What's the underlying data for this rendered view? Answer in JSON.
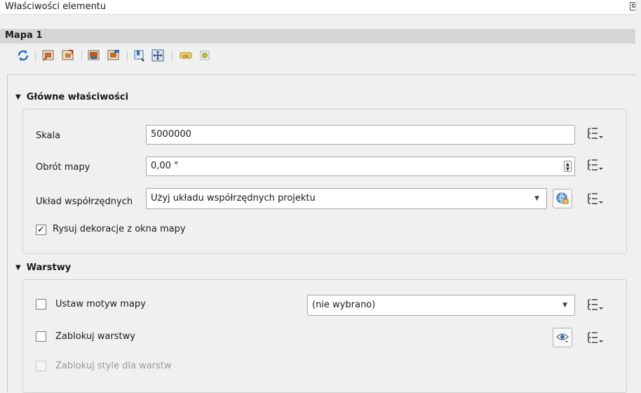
{
  "window": {
    "title": "Właściwości elementu"
  },
  "item": {
    "name": "Mapa 1"
  },
  "toolbar": {
    "icons": [
      "refresh-icon",
      "set-extent-from-canvas-icon",
      "view-extent-in-canvas-icon",
      "set-scale-from-canvas-icon",
      "set-canvas-scale-icon",
      "bookmarks-icon",
      "move-content-icon",
      "label-settings-icon",
      "clipping-settings-icon"
    ]
  },
  "main_properties": {
    "header": "Główne właściwości",
    "scale_label": "Skala",
    "scale_value": "5000000",
    "rotation_label": "Obrót mapy",
    "rotation_value": "0,00 °",
    "crs_label": "Układ współrzędnych",
    "crs_value": "Użyj układu współrzędnych projektu",
    "draw_decorations_label": "Rysuj dekoracje z okna mapy",
    "draw_decorations_checked": true
  },
  "layers": {
    "header": "Warstwy",
    "follow_theme_label": "Ustaw motyw mapy",
    "theme_value": "(nie wybrano)",
    "lock_layers_label": "Zablokuj warstwy",
    "lock_styles_label": "Zablokuj style dla warstw"
  },
  "colors": {
    "accent_blue": "#2a6cc1",
    "section_bar": "#d6d6d6"
  }
}
